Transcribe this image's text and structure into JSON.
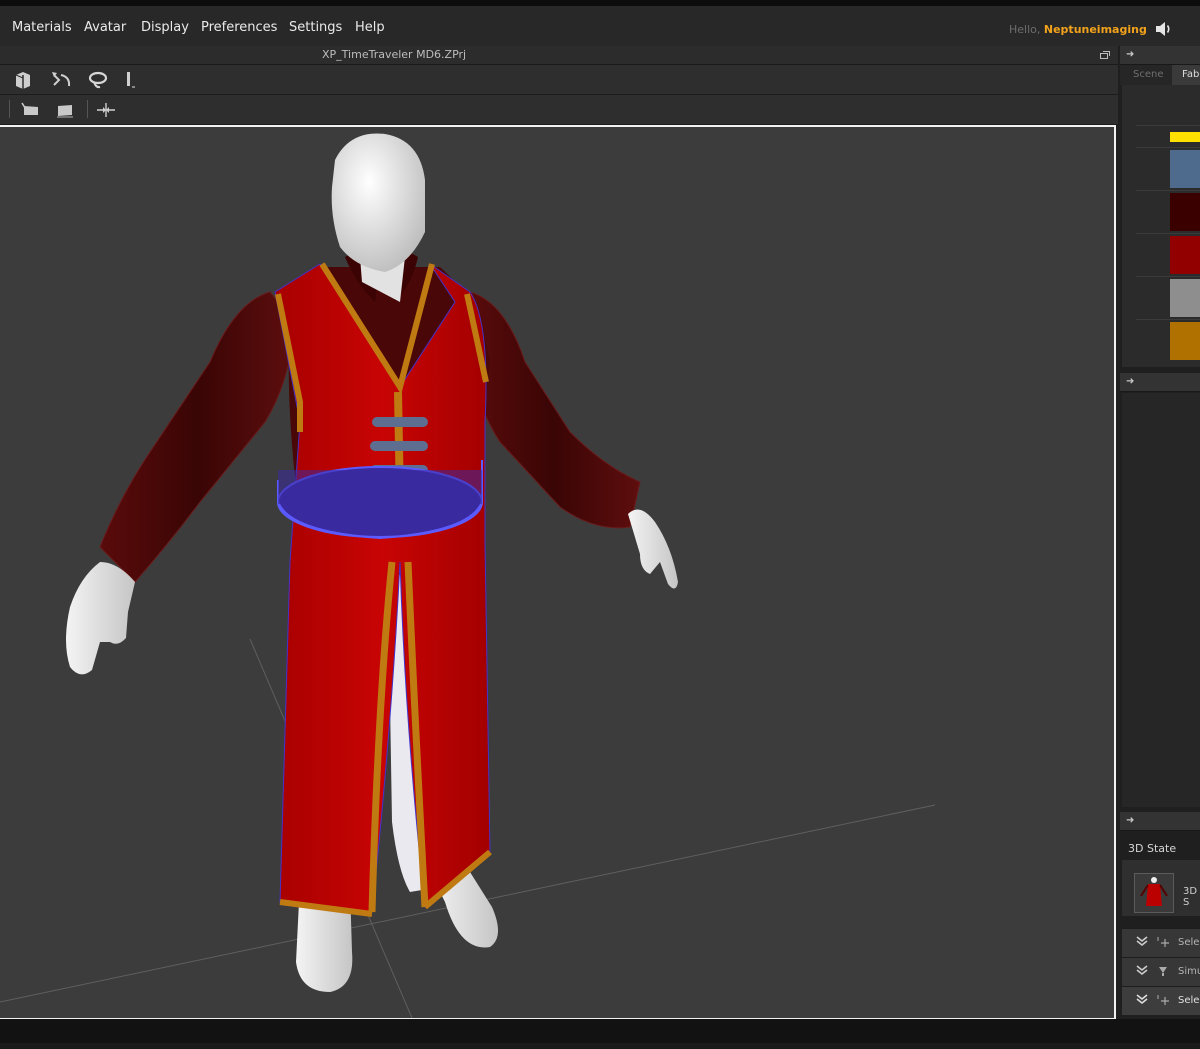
{
  "menu": {
    "items": [
      "Materials",
      "Avatar",
      "Display",
      "Preferences",
      "Settings",
      "Help"
    ],
    "greeting_prefix": "Hello,",
    "username": "Neptuneimaging"
  },
  "window": {
    "title": "XP_TimeTraveler MD6.ZPrj"
  },
  "toolbar": {
    "row1": [
      "select-mesh-icon",
      "transform-pattern-icon",
      "lasso-icon",
      "pin-icon"
    ],
    "row2": [
      "tack-icon",
      "flatten-icon",
      "distance-icon"
    ]
  },
  "right_panel": {
    "tabs": [
      "Scene",
      "Fab"
    ],
    "fabric_colors": [
      "#ffe100",
      "#4e6a8c",
      "#3a0000",
      "#930000",
      "#8e8e8e",
      "#b07100"
    ],
    "state_label": "3D State",
    "state_thumb_label": "3D S",
    "history": [
      {
        "icon": "select-move-icon",
        "label": "Selec"
      },
      {
        "icon": "simulation-icon",
        "label": "Simu"
      },
      {
        "icon": "select-move-icon",
        "label": "Selec"
      }
    ]
  },
  "colors": {
    "accent_username": "#f2a21b",
    "viewport_bg": "#3c3c3c",
    "robe_red": "#bd0202",
    "shirt_maroon": "#4d0909",
    "trim_gold": "#c07a12",
    "belt_selection": "#3a2aa0"
  }
}
